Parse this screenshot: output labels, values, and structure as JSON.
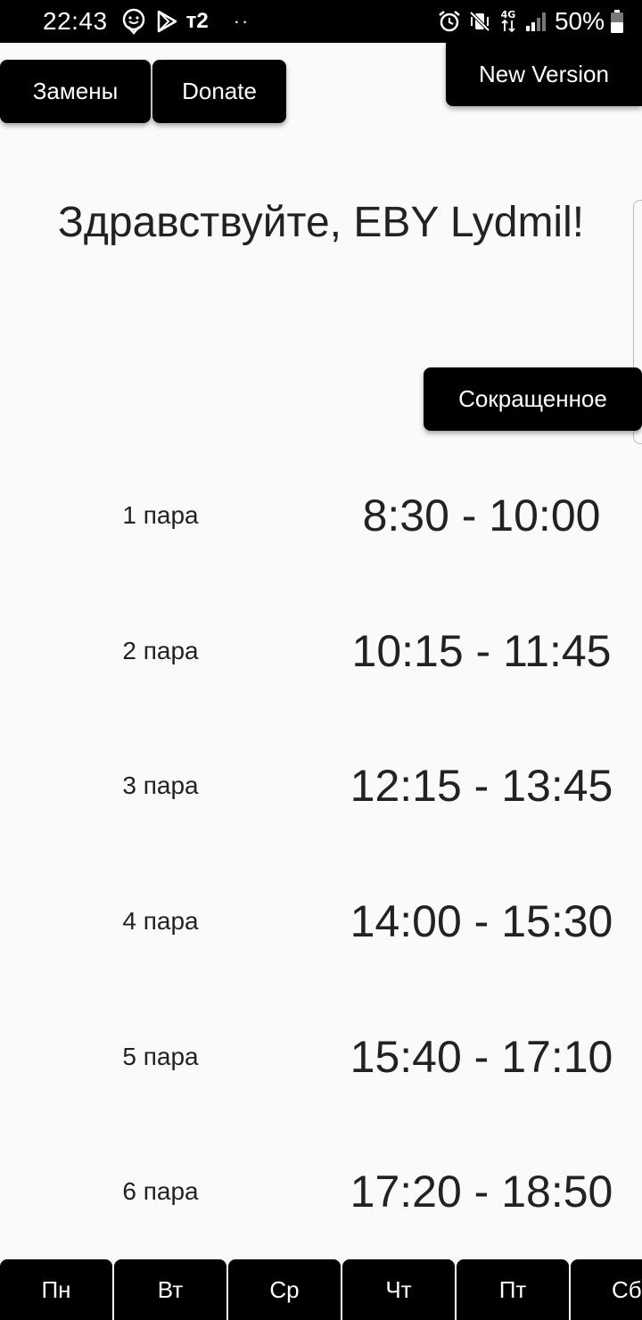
{
  "status_bar": {
    "time": "22:43",
    "carrier": "т2",
    "dots": "··",
    "network": "4G",
    "battery": "50%",
    "left_icons": [
      "smiley-pin-icon",
      "play-store-icon"
    ],
    "right_icons": [
      "alarm-icon",
      "vibrate-mute-icon",
      "4g-data-icon",
      "signal-icon",
      "battery-icon"
    ]
  },
  "top_buttons": {
    "zameny": "Замены",
    "donate": "Donate",
    "new_version": "New Version"
  },
  "greeting": "Здравствуйте, EBY Lydmil!",
  "mode_button": "Сокращенное",
  "schedule": [
    {
      "label": "1 пара",
      "time": "8:30 - 10:00"
    },
    {
      "label": "2 пара",
      "time": "10:15 - 11:45"
    },
    {
      "label": "3 пара",
      "time": "12:15 - 13:45"
    },
    {
      "label": "4 пара",
      "time": "14:00 - 15:30"
    },
    {
      "label": "5 пара",
      "time": "15:40 - 17:10"
    },
    {
      "label": "6 пара",
      "time": "17:20 - 18:50"
    }
  ],
  "day_tabs": [
    "Пн",
    "Вт",
    "Ср",
    "Чт",
    "Пт",
    "Сб"
  ],
  "colors": {
    "background": "#fafafa",
    "button": "#000000",
    "button_text": "#ffffff",
    "text": "#222222"
  }
}
